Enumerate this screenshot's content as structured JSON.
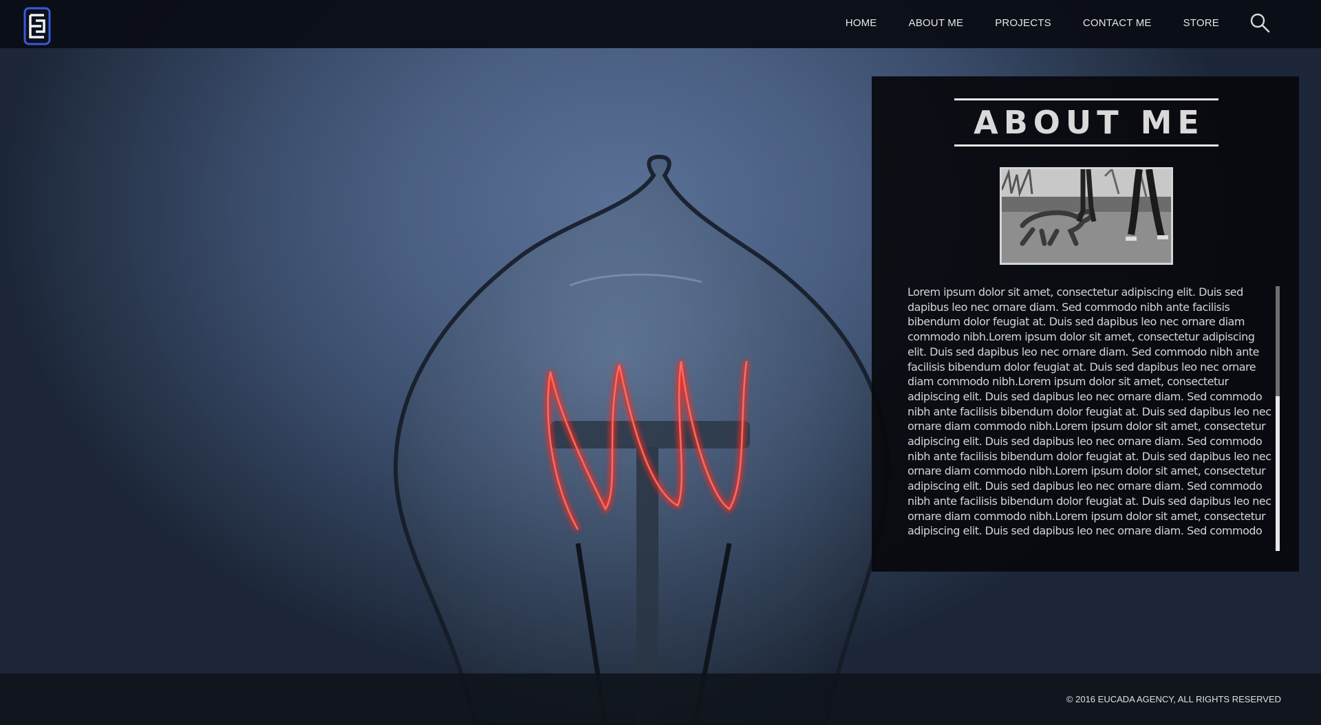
{
  "header": {
    "logo_icon": "eucada-logo-icon",
    "nav": [
      {
        "label": "HOME"
      },
      {
        "label": "ABOUT ME"
      },
      {
        "label": "PROJECTS"
      },
      {
        "label": "CONTACT ME"
      },
      {
        "label": "STORE"
      }
    ],
    "search_icon": "search-icon"
  },
  "about": {
    "title": "ABOUT ME",
    "photo_icon": "profile-photo",
    "body": "Lorem ipsum dolor sit amet, consectetur adipiscing elit. Duis sed dapibus leo nec ornare diam. Sed commodo nibh ante facilisis bibendum dolor feugiat at. Duis sed dapibus leo nec ornare diam commodo nibh.Lorem ipsum dolor sit amet, consectetur adipiscing elit. Duis sed dapibus leo nec ornare diam. Sed commodo nibh ante facilisis bibendum dolor feugiat at. Duis sed dapibus leo nec ornare diam commodo nibh.Lorem ipsum dolor sit amet, consectetur adipiscing elit. Duis sed dapibus leo nec ornare diam. Sed commodo nibh ante facilisis bibendum dolor feugiat at. Duis sed dapibus leo nec ornare diam commodo nibh.Lorem ipsum dolor sit amet, consectetur adipiscing elit. Duis sed dapibus leo nec ornare diam. Sed commodo nibh ante facilisis bibendum dolor feugiat at. Duis sed dapibus leo nec ornare diam commodo nibh.Lorem ipsum dolor sit amet, consectetur adipiscing elit. Duis sed dapibus leo nec ornare diam. Sed commodo nibh ante facilisis bibendum dolor feugiat at. Duis sed dapibus leo nec ornare diam commodo nibh.Lorem ipsum dolor sit amet, consectetur adipiscing elit. Duis sed dapibus leo nec ornare diam. Sed commodo nibh ante facilisis bibendum dolor feugiat at. Duis sed dapibus leo nec ornare diam commodo nibh.Lorem ipsum dolor sit amet."
  },
  "footer": {
    "copyright": "© 2016 EUCADA AGENCY, ALL RIGHTS RESERVED"
  },
  "colors": {
    "bar_bg": "#0a0d14",
    "panel_bg": "#07090d",
    "filament": "#ff3b2f",
    "logo_accent": "#3a5ad8"
  }
}
